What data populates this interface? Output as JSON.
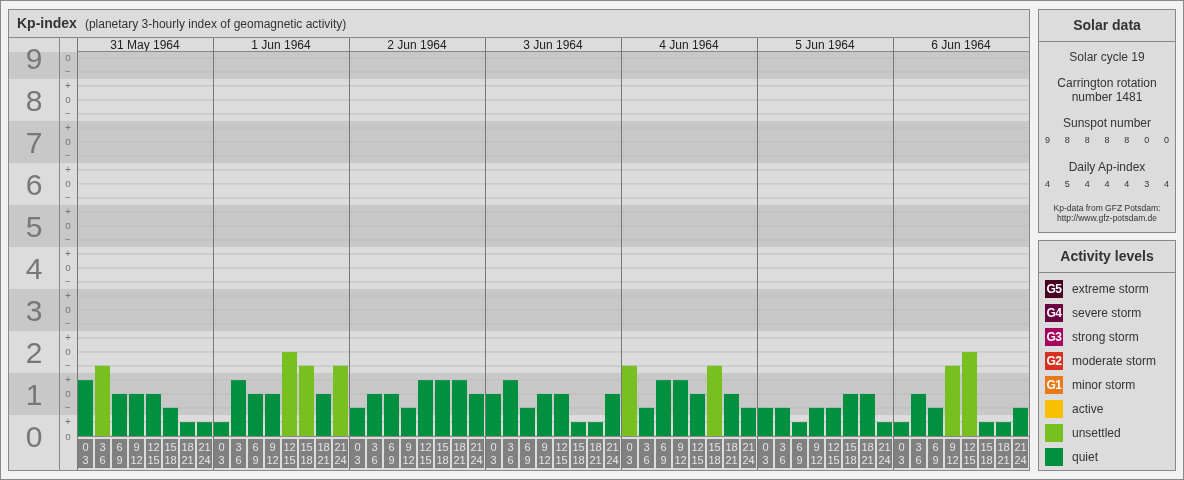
{
  "header": {
    "title": "Kp-index",
    "subtitle": "(planetary 3-hourly index of geomagnetic activity)"
  },
  "kp_chart": {
    "days": [
      "31 May 1964",
      "1 Jun 1964",
      "2 Jun 1964",
      "3 Jun 1964",
      "4 Jun 1964",
      "5 Jun 1964",
      "6 Jun 1964"
    ],
    "kp_marks": [
      "o",
      "−",
      "+",
      "o",
      "−",
      "+",
      "o",
      "−",
      "+",
      "o",
      "−",
      "+",
      "o",
      "−",
      "+",
      "o",
      "−",
      "+",
      "o",
      "−",
      "+",
      "o",
      "−",
      "+",
      "o",
      "−",
      "+",
      "o"
    ],
    "chart_data": {
      "type": "bar",
      "grid": true,
      "bands": [
        {
          "axis": "y",
          "from": 0.5,
          "to": 1.5,
          "color": "#c8c8c8"
        },
        {
          "axis": "y",
          "from": 2.5,
          "to": 3.5,
          "color": "#c8c8c8"
        },
        {
          "axis": "y",
          "from": 4.5,
          "to": 5.5,
          "color": "#c8c8c8"
        },
        {
          "axis": "y",
          "from": 6.5,
          "to": 7.5,
          "color": "#c8c8c8"
        },
        {
          "axis": "y",
          "from": 8.5,
          "to": 9.14,
          "color": "#c8c8c8"
        }
      ],
      "categories": [
        "0 3",
        "3 6",
        "6 9",
        "9 12",
        "12 15",
        "15 18",
        "18 21",
        "21 24",
        "0 3",
        "3 6",
        "6 9",
        "9 12",
        "12 15",
        "15 18",
        "18 21",
        "21 24",
        "0 3",
        "3 6",
        "6 9",
        "9 12",
        "12 15",
        "15 18",
        "18 21",
        "21 24",
        "0 3",
        "3 6",
        "6 9",
        "9 12",
        "12 15",
        "15 18",
        "18 21",
        "21 24",
        "0 3",
        "3 6",
        "6 9",
        "9 12",
        "12 15",
        "15 18",
        "18 21",
        "21 24",
        "0 3",
        "3 6",
        "6 9",
        "9 12",
        "12 15",
        "15 18",
        "18 21",
        "21 24",
        "0 3",
        "3 6",
        "6 9",
        "9 12",
        "12 15",
        "15 18",
        "18 21",
        "21 24"
      ],
      "ylim": [
        0,
        9.14
      ],
      "yticks": [
        {
          "value": 0,
          "label": "0"
        },
        {
          "value": 1,
          "label": "1"
        },
        {
          "value": 2,
          "label": "2"
        },
        {
          "value": 3,
          "label": "3"
        },
        {
          "value": 4,
          "label": "4"
        },
        {
          "value": 5,
          "label": "5"
        },
        {
          "value": 6,
          "label": "6"
        },
        {
          "value": 7,
          "label": "7"
        },
        {
          "value": 8,
          "label": "8"
        },
        {
          "value": 9,
          "label": "9"
        }
      ],
      "series": [
        {
          "color": "#009040",
          "values": [
            1.33,
            null,
            1,
            1,
            1,
            0.67,
            0.33,
            0.33,
            0.33,
            1.33,
            1,
            1,
            null,
            null,
            1,
            null,
            0.67,
            1,
            1,
            0.67,
            1.33,
            1.33,
            1.33,
            1,
            1,
            1.33,
            0.67,
            1,
            1,
            0.33,
            0.33,
            1,
            null,
            0.67,
            1.33,
            1.33,
            1,
            null,
            1,
            0.67,
            0.67,
            0.67,
            0.33,
            0.67,
            0.67,
            1,
            1,
            0.33,
            0.33,
            1,
            0.67,
            null,
            null,
            0.33,
            0.33,
            0.67
          ]
        },
        {
          "color": "#78c020",
          "values": [
            null,
            1.67,
            null,
            null,
            null,
            null,
            null,
            null,
            null,
            null,
            null,
            null,
            2,
            1.67,
            null,
            1.67,
            null,
            null,
            null,
            null,
            null,
            null,
            null,
            null,
            null,
            null,
            null,
            null,
            null,
            null,
            null,
            null,
            1.67,
            null,
            null,
            null,
            null,
            1.67,
            null,
            null,
            null,
            null,
            null,
            null,
            null,
            null,
            null,
            null,
            null,
            null,
            null,
            1.67,
            2,
            null,
            null,
            null
          ]
        }
      ]
    }
  },
  "solar_data": {
    "title": "Solar data",
    "solar_cycle": "Solar cycle 19",
    "carrington_rotation": "Carrington rotation number 1481",
    "sunspot_label": "Sunspot number",
    "sunspot_numbers": [
      "9",
      "8",
      "8",
      "8",
      "8",
      "0",
      "0"
    ],
    "ap_label": "Daily Ap-index",
    "ap_values": [
      "4",
      "5",
      "4",
      "4",
      "4",
      "3",
      "4"
    ],
    "source_lines": [
      "Kp-data from GFZ Potsdam:",
      "http://www.gfz-potsdam.de"
    ]
  },
  "activity_levels": {
    "title": "Activity levels",
    "items": [
      {
        "badge": "G5",
        "label": "extreme storm",
        "color": "#4a0020"
      },
      {
        "badge": "G4",
        "label": "severe storm",
        "color": "#6a0040"
      },
      {
        "badge": "G3",
        "label": "strong storm",
        "color": "#a80060"
      },
      {
        "badge": "G2",
        "label": "moderate storm",
        "color": "#d83020"
      },
      {
        "badge": "G1",
        "label": "minor storm",
        "color": "#e87818"
      },
      {
        "label": "active",
        "color": "#f8c000"
      },
      {
        "label": "unsettled",
        "color": "#78c020"
      },
      {
        "label": "quiet",
        "color": "#009040"
      }
    ]
  }
}
